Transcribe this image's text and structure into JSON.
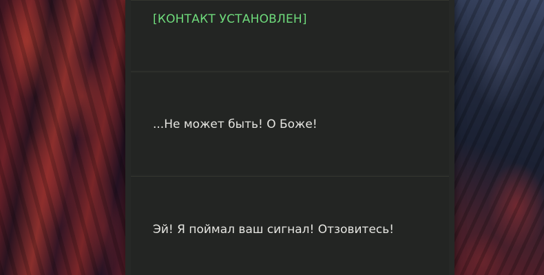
{
  "messages": [
    {
      "text": "[КОНТАКТ УСТАНОВЛЕН]",
      "kind": "status",
      "color": "#6fdc7c"
    },
    {
      "text": "...Не может быть! О Боже!",
      "kind": "dialogue"
    },
    {
      "text": "Эй! Я поймал ваш сигнал! Отзовитесь!",
      "kind": "dialogue"
    }
  ],
  "colors": {
    "panel": "#262826",
    "card": "#232523",
    "text": "#e6e6e2",
    "status": "#6fdc7c"
  }
}
